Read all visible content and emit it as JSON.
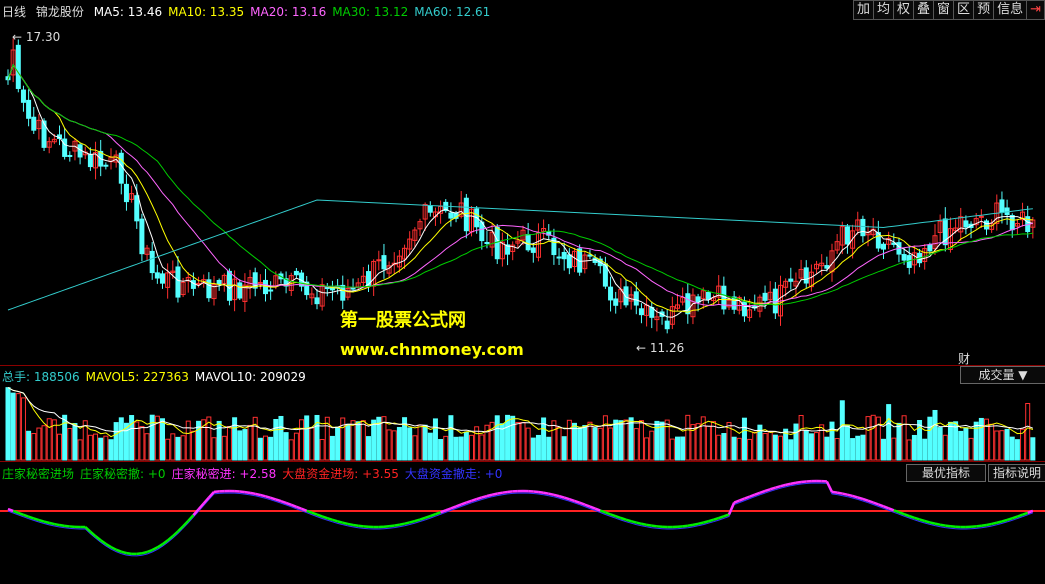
{
  "header": {
    "period": "日线",
    "stock_name": "锦龙股份",
    "ma": [
      {
        "label": "MA5:",
        "value": "13.46",
        "color": "#ffffff"
      },
      {
        "label": "MA10:",
        "value": "13.35",
        "color": "#ffff00"
      },
      {
        "label": "MA20:",
        "value": "13.16",
        "color": "#ff66ff"
      },
      {
        "label": "MA30:",
        "value": "13.12",
        "color": "#00cc00"
      },
      {
        "label": "MA60:",
        "value": "12.61",
        "color": "#33cccc"
      }
    ]
  },
  "toolbar": {
    "items": [
      "加",
      "均",
      "权",
      "叠",
      "窗",
      "区",
      "预",
      "信息",
      "⇥"
    ]
  },
  "price_panel": {
    "high_label": "17.30",
    "low_label": "11.26",
    "fin_label": "财"
  },
  "watermark": {
    "line1": "第一股票公式网",
    "line2": "www.chnmoney.com"
  },
  "volume_panel": {
    "items": [
      {
        "label": "总手:",
        "value": "188506",
        "color": "#33cccc"
      },
      {
        "label": "MAVOL5:",
        "value": "227363",
        "color": "#ffff00"
      },
      {
        "label": "MAVOL10:",
        "value": "209029",
        "color": "#ffffff"
      }
    ],
    "dropdown": "成交量"
  },
  "indicator_panel": {
    "items": [
      {
        "label": "庄家秘密进场",
        "value": "",
        "color": "#00cc00"
      },
      {
        "label": "庄家秘密撤:",
        "value": "+0",
        "color": "#00cc00"
      },
      {
        "label": "庄家秘密进:",
        "value": "+2.58",
        "color": "#ff33ff"
      },
      {
        "label": "大盘资金进场:",
        "value": "+3.55",
        "color": "#ff2222"
      },
      {
        "label": "大盘资金撤走:",
        "value": "+0",
        "color": "#3333ff"
      }
    ],
    "buttons": [
      "最优指标",
      "指标说明"
    ]
  }
}
